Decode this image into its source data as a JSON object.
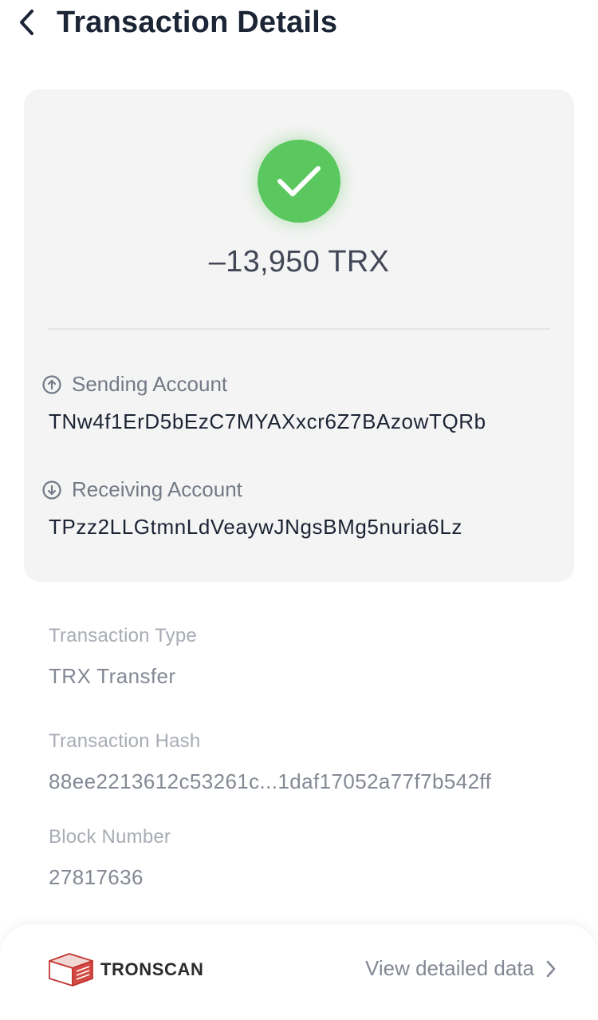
{
  "header": {
    "title": "Transaction Details",
    "back_icon": "chevron-left-icon"
  },
  "summary": {
    "status_icon": "check-circle-icon",
    "status_color": "#5ac85e",
    "amount": "–13,950 TRX",
    "sending": {
      "label": "Sending Account",
      "icon": "arrow-up-circle-icon",
      "address": "TNw4f1ErD5bEzC7MYAXxcr6Z7BAzowTQRb"
    },
    "receiving": {
      "label": "Receiving Account",
      "icon": "arrow-down-circle-icon",
      "address": "TPzz2LLGtmnLdVeaywJNgsBMg5nuria6Lz"
    }
  },
  "details": {
    "type_label": "Transaction Type",
    "type_value": "TRX Transfer",
    "hash_label": "Transaction Hash",
    "hash_value": "88ee2213612c53261c...1daf17052a77f7b542ff",
    "block_label": "Block Number",
    "block_value": "27817636"
  },
  "footer": {
    "brand_logo": "tronscan-logo-icon",
    "brand_name": "TRONSCAN",
    "brand_color": "#c23631",
    "view_link": "View detailed data",
    "chevron_icon": "chevron-right-icon"
  }
}
